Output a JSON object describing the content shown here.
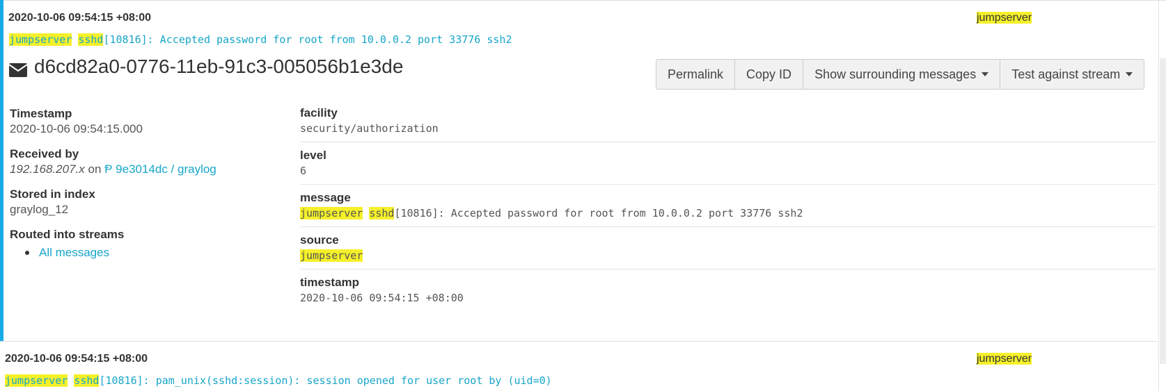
{
  "message1": {
    "timestamp_header": "2020-10-06 09:54:15 +08:00",
    "source_badge": "jumpserver",
    "summary": {
      "hl1": "jumpserver",
      "hl2": "sshd",
      "rest": "[10816]: Accepted password for root from 10.0.0.2 port 33776 ssh2"
    },
    "id": "d6cd82a0-0776-11eb-91c3-005056b1e3de",
    "actions": {
      "permalink": "Permalink",
      "copy_id": "Copy ID",
      "surrounding": "Show surrounding messages",
      "test_stream": "Test against stream"
    },
    "meta": {
      "timestamp_label": "Timestamp",
      "timestamp_value": "2020-10-06 09:54:15.000",
      "received_label": "Received by",
      "received_ip": "192.168.207.x",
      "received_on": "on",
      "received_node": "9e3014dc / graylog",
      "index_label": "Stored in index",
      "index_value": "graylog_12",
      "streams_label": "Routed into streams",
      "streams": [
        "All messages"
      ]
    },
    "fields": {
      "facility_name": "facility",
      "facility_value": "security/authorization",
      "level_name": "level",
      "level_value": "6",
      "message_name": "message",
      "message_hl1": "jumpserver",
      "message_hl2": "sshd",
      "message_rest": "[10816]: Accepted password for root from 10.0.0.2 port 33776 ssh2",
      "source_name": "source",
      "source_value": "jumpserver",
      "timestamp_name": "timestamp",
      "timestamp_value": "2020-10-06 09:54:15 +08:00"
    }
  },
  "message2": {
    "timestamp_header": "2020-10-06 09:54:15 +08:00",
    "source_badge": "jumpserver",
    "summary": {
      "hl1": "jumpserver",
      "hl2": "sshd",
      "rest": "[10816]: pam_unix(sshd:session): session opened for user root by (uid=0)"
    }
  },
  "colors": {
    "accent": "#16ace3",
    "link": "#16a6c9",
    "highlight": "#f5f02a"
  },
  "icons": {
    "title_icon": "envelope-icon",
    "node_icon": "node-icon"
  }
}
